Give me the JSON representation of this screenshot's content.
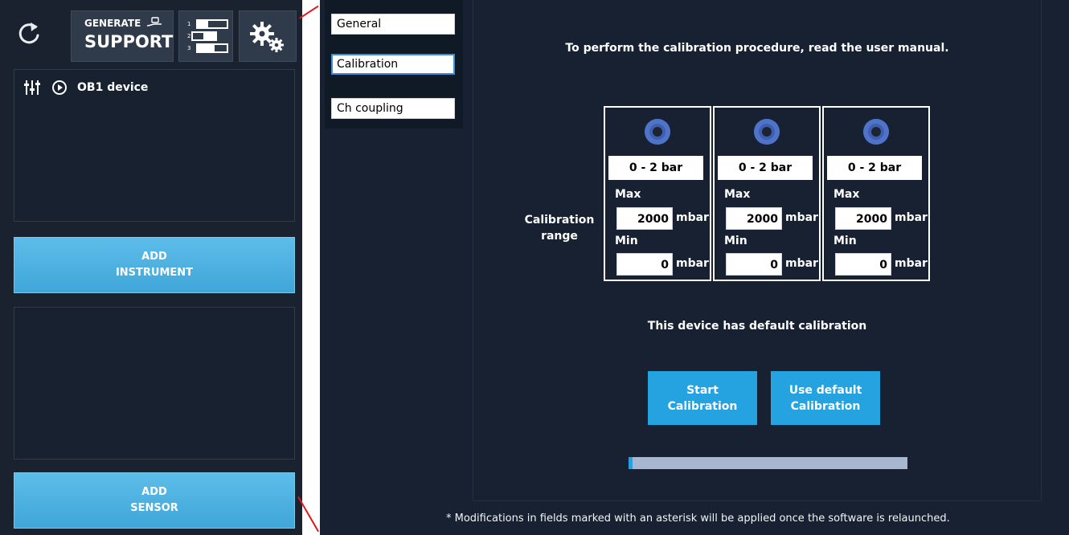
{
  "app": {
    "toolbar": {
      "generate_label_top": "GENERATE",
      "generate_label_bottom": "SUPPORT"
    },
    "instrument": {
      "name": "OB1 device"
    },
    "add_instrument": [
      "ADD",
      "INSTRUMENT"
    ],
    "add_sensor": [
      "ADD",
      "SENSOR"
    ]
  },
  "tabs": [
    {
      "label": "General",
      "active": false
    },
    {
      "label": "Calibration",
      "active": true
    },
    {
      "label": "Ch coupling",
      "active": false
    }
  ],
  "calibration": {
    "instruction": "To perform the calibration procedure, read the user manual.",
    "range_label": [
      "Calibration",
      "range"
    ],
    "channels": [
      {
        "range": "0 - 2 bar",
        "max_label": "Max",
        "max_value": "2000",
        "max_unit": "mbar",
        "min_label": "Min",
        "min_value": "0",
        "min_unit": "mbar"
      },
      {
        "range": "0 - 2 bar",
        "max_label": "Max",
        "max_value": "2000",
        "max_unit": "mbar",
        "min_label": "Min",
        "min_value": "0",
        "min_unit": "mbar"
      },
      {
        "range": "0 - 2 bar",
        "max_label": "Max",
        "max_value": "2000",
        "max_unit": "mbar",
        "min_label": "Min",
        "min_value": "0",
        "min_unit": "mbar"
      }
    ],
    "status": "This device has default calibration",
    "start_button": [
      "Start",
      "Calibration"
    ],
    "default_button": [
      "Use default",
      "Calibration"
    ],
    "progress_fraction": 0.014
  },
  "footer_note": "* Modifications in fields marked with an asterisk will be applied once the software is relaunched.",
  "colors": {
    "accent_blue": "#24a3e0",
    "panel_dark": "#172131",
    "progress_track": "#a8b6cf"
  }
}
